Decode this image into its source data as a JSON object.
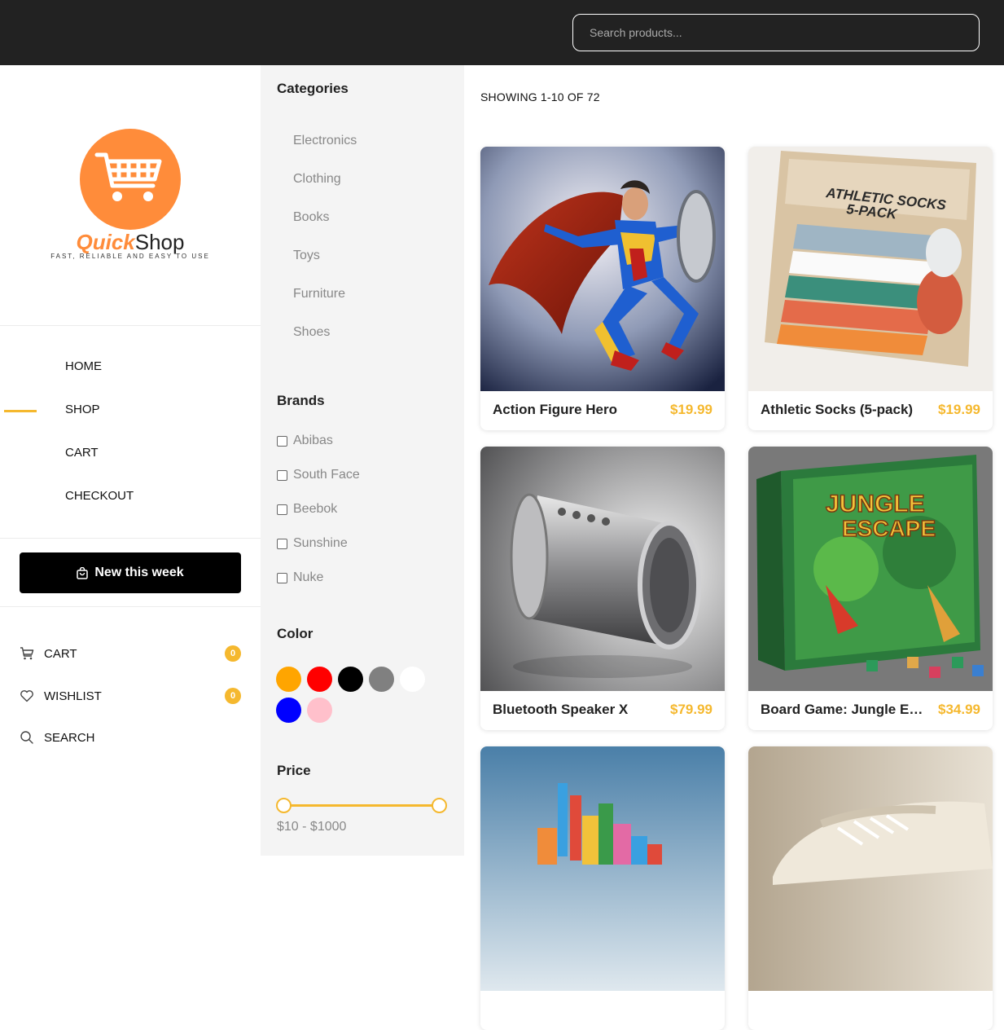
{
  "search": {
    "placeholder": "Search products..."
  },
  "brand": {
    "name_part1": "Quick",
    "name_part2": "Shop",
    "tagline": "FAST, RELIABLE AND EASY TO USE"
  },
  "nav": {
    "items": [
      {
        "label": "HOME",
        "active": false
      },
      {
        "label": "SHOP",
        "active": true
      },
      {
        "label": "CART",
        "active": false
      },
      {
        "label": "CHECKOUT",
        "active": false
      }
    ],
    "new_this_week": "New this week"
  },
  "utilities": {
    "cart": {
      "label": "CART",
      "count": "0"
    },
    "wishlist": {
      "label": "WISHLIST",
      "count": "0"
    },
    "search": {
      "label": "SEARCH"
    }
  },
  "filters": {
    "categories_title": "Categories",
    "categories": [
      "Electronics",
      "Clothing",
      "Books",
      "Toys",
      "Furniture",
      "Shoes"
    ],
    "brands_title": "Brands",
    "brands": [
      "Abibas",
      "South Face",
      "Beebok",
      "Sunshine",
      "Nuke"
    ],
    "color_title": "Color",
    "colors": [
      "#ffa500",
      "#ff0000",
      "#000000",
      "#808080",
      "#ffffff",
      "#0000ff",
      "#ffc0cb"
    ],
    "price_title": "Price",
    "price_range": "$10 - $1000"
  },
  "results": {
    "showing": "SHOWING 1-10 OF 72"
  },
  "products": [
    {
      "name": "Action Figure Hero",
      "price": "$19.99"
    },
    {
      "name": "Athletic Socks (5-pack)",
      "price": "$19.99"
    },
    {
      "name": "Bluetooth Speaker X",
      "price": "$79.99"
    },
    {
      "name": "Board Game: Jungle Escape",
      "price": "$34.99"
    },
    {
      "name": "",
      "price": ""
    },
    {
      "name": "",
      "price": ""
    }
  ],
  "accent_color": "#f5b82e",
  "logo_color": "#ff8c3a"
}
